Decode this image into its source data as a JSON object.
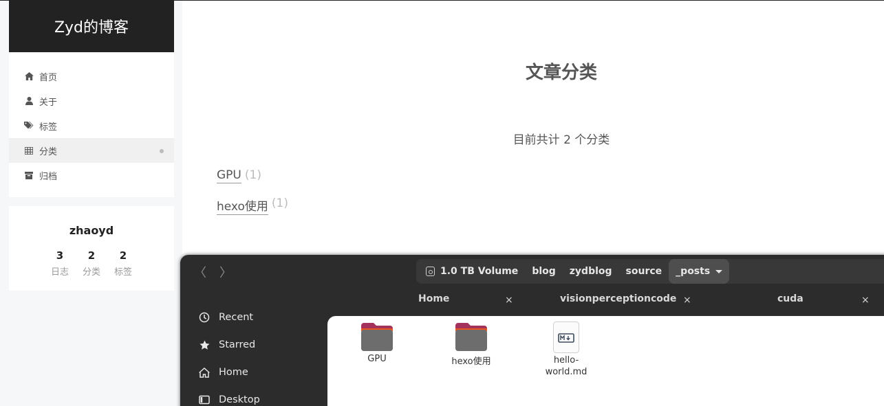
{
  "blog": {
    "title": "Zyd的博客",
    "menu": [
      {
        "label": "首页",
        "icon": "home-icon"
      },
      {
        "label": "关于",
        "icon": "user-icon"
      },
      {
        "label": "标签",
        "icon": "tags-icon"
      },
      {
        "label": "分类",
        "icon": "th-icon",
        "active": true
      },
      {
        "label": "归档",
        "icon": "archive-icon"
      }
    ],
    "author": {
      "name": "zhaoyd",
      "stats": [
        {
          "count": "3",
          "label": "日志"
        },
        {
          "count": "2",
          "label": "分类"
        },
        {
          "count": "2",
          "label": "标签"
        }
      ]
    },
    "page_title": "文章分类",
    "category_count_text": "目前共计 2 个分类",
    "categories": [
      {
        "name": "GPU",
        "count": "(1)"
      },
      {
        "name": "hexo使用",
        "count": "(1)"
      }
    ]
  },
  "files": {
    "nav": {
      "back": "〈",
      "forward": "〉"
    },
    "path": [
      "1.0 TB Volume",
      "blog",
      "zydblog",
      "source",
      "_posts"
    ],
    "tabs": [
      {
        "label": "Home",
        "close": "×"
      },
      {
        "label": "visionperceptioncode",
        "close": "×"
      },
      {
        "label": "cuda",
        "close": "×"
      }
    ],
    "sidebar": [
      {
        "label": "Recent",
        "icon": "clock-icon"
      },
      {
        "label": "Starred",
        "icon": "star-icon"
      },
      {
        "label": "Home",
        "icon": "home-icon"
      },
      {
        "label": "Desktop",
        "icon": "desktop-icon"
      }
    ],
    "items": [
      {
        "name": "GPU",
        "type": "folder"
      },
      {
        "name": "hexo使用",
        "type": "folder"
      },
      {
        "name": "hello-\nworld.md",
        "type": "markdown-file"
      }
    ]
  },
  "colors": {
    "brand_bg": "#222222",
    "page_bg": "#f5f7f9",
    "nautilus_bg": "#2c2c2c",
    "folder_top": "#e95420"
  }
}
